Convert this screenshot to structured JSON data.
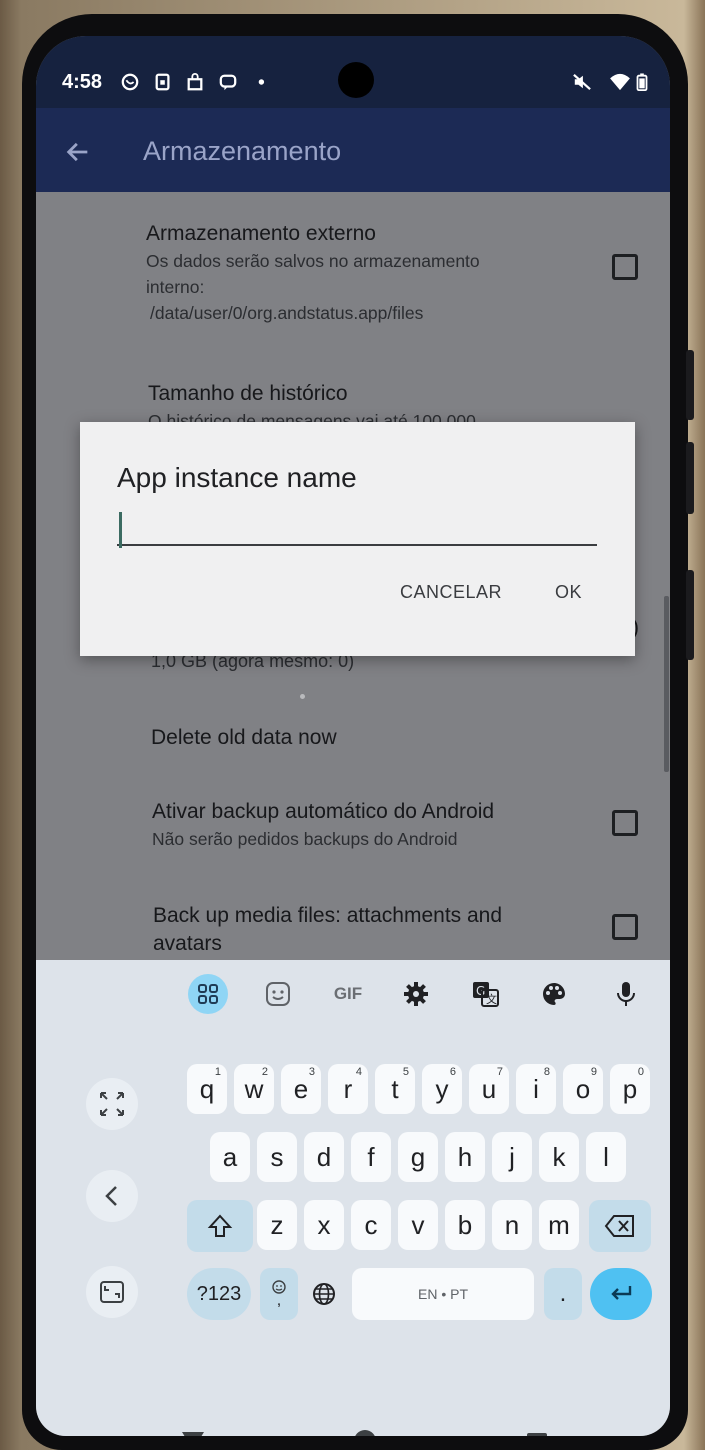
{
  "status_bar": {
    "time": "4:58",
    "icons": [
      "whatsapp-icon",
      "sim-icon",
      "shop-icon",
      "messages-icon",
      "dot-icon"
    ],
    "right_icons": [
      "mute-icon",
      "wifi-icon",
      "battery-icon"
    ]
  },
  "app_bar": {
    "title": "Armazenamento",
    "back_icon": "arrow-back-icon"
  },
  "settings": {
    "external_storage": {
      "title": "Armazenamento externo",
      "summary_line1": "Os dados serão salvos no armazenamento",
      "summary_line2": "interno:",
      "summary_line3": "/data/user/0/org.andstatus.app/files",
      "checked": false
    },
    "history_size": {
      "title": "Tamanho de histórico",
      "summary": "O histórico de mensagens vai até 100.000"
    },
    "cache_size": {
      "partial_right": ")",
      "summary": "1,0 GB (agora mesmo: 0)"
    },
    "delete_old": {
      "title": "Delete old data now"
    },
    "auto_backup": {
      "title": "Ativar backup automático do Android",
      "summary": "Não serão pedidos backups do Android",
      "checked": false
    },
    "backup_media": {
      "title_line1": "Back up media files: attachments and",
      "title_line2": "avatars",
      "checked": false
    }
  },
  "dialog": {
    "title": "App instance name",
    "input_value": "",
    "cancel_label": "CANCELAR",
    "ok_label": "OK"
  },
  "keyboard": {
    "toolbar": [
      "apps-grid-icon",
      "sticker-icon",
      "GIF",
      "gear-icon",
      "translate-icon",
      "palette-icon",
      "microphone-icon"
    ],
    "gif_label": "GIF",
    "row1": [
      {
        "key": "q",
        "hint": "1"
      },
      {
        "key": "w",
        "hint": "2"
      },
      {
        "key": "e",
        "hint": "3"
      },
      {
        "key": "r",
        "hint": "4"
      },
      {
        "key": "t",
        "hint": "5"
      },
      {
        "key": "y",
        "hint": "6"
      },
      {
        "key": "u",
        "hint": "7"
      },
      {
        "key": "i",
        "hint": "8"
      },
      {
        "key": "o",
        "hint": "9"
      },
      {
        "key": "p",
        "hint": "0"
      }
    ],
    "row2": [
      "a",
      "s",
      "d",
      "f",
      "g",
      "h",
      "j",
      "k",
      "l"
    ],
    "row3": [
      "z",
      "x",
      "c",
      "v",
      "b",
      "n",
      "m"
    ],
    "symbols_label": "?123",
    "emoji_comma": ",",
    "space_label": "EN • PT",
    "period_label": "."
  },
  "nav_bar": {
    "icons": [
      "back-triangle-icon",
      "home-circle-icon",
      "recents-square-icon",
      "keyboard-switch-icon"
    ]
  }
}
